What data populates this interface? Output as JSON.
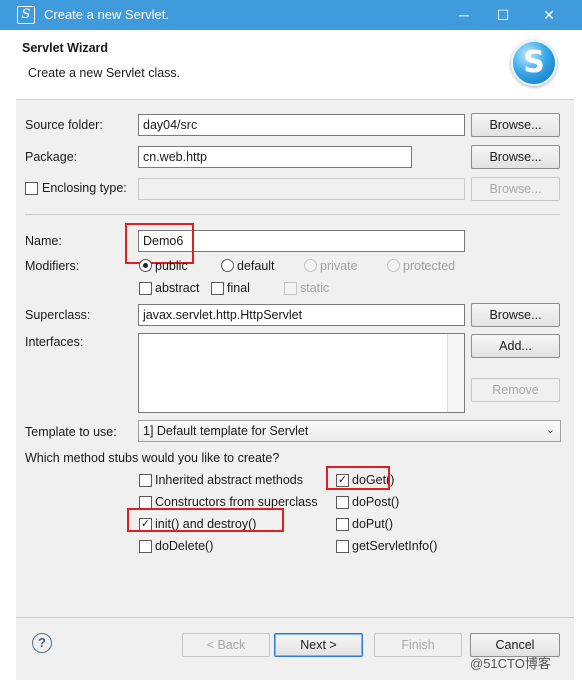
{
  "window": {
    "title": "Create a new Servlet.",
    "minimize": "─",
    "maximize": "☐",
    "close": "✕"
  },
  "header": {
    "title": "Servlet Wizard",
    "description": "Create a new Servlet class.",
    "logo_letter": "S"
  },
  "form": {
    "source_folder": {
      "label": "Source folder:",
      "value": "day04/src",
      "button": "Browse..."
    },
    "package": {
      "label": "Package:",
      "value": "cn.web.http",
      "button": "Browse..."
    },
    "enclosing_type": {
      "label": "Enclosing type:",
      "value": "",
      "checked": false,
      "button": "Browse..."
    },
    "name": {
      "label": "Name:",
      "value": "Demo6"
    },
    "modifiers": {
      "label": "Modifiers:",
      "public": "public",
      "default": "default",
      "private": "private",
      "protected": "protected",
      "abstract": "abstract",
      "final": "final",
      "static": "static"
    },
    "superclass": {
      "label": "Superclass:",
      "value": "javax.servlet.http.HttpServlet",
      "button": "Browse..."
    },
    "interfaces": {
      "label": "Interfaces:",
      "add_button": "Add...",
      "remove_button": "Remove"
    },
    "template": {
      "label": "Template to use:",
      "selected": "1] Default template for Servlet"
    }
  },
  "stubs": {
    "question": "Which method stubs would you like to create?",
    "inherited_abstract": {
      "label": "Inherited abstract methods",
      "checked": false
    },
    "constructors": {
      "label": "Constructors from superclass",
      "checked": false
    },
    "init_destroy": {
      "label": "init() and destroy()",
      "checked": true
    },
    "doDelete": {
      "label": "doDelete()",
      "checked": false
    },
    "doGet": {
      "label": "doGet()",
      "checked": true
    },
    "doPost": {
      "label": "doPost()",
      "checked": false
    },
    "doPut": {
      "label": "doPut()",
      "checked": false
    },
    "getServletInfo": {
      "label": "getServletInfo()",
      "checked": false
    },
    "check_mark": "✓"
  },
  "footer": {
    "help": "?",
    "back": "< Back",
    "next": "Next >",
    "finish": "Finish",
    "cancel": "Cancel"
  },
  "watermark": "@51CTO博客",
  "colors": {
    "titlebar": "#3f9bdb",
    "highlight": "#e02020"
  }
}
